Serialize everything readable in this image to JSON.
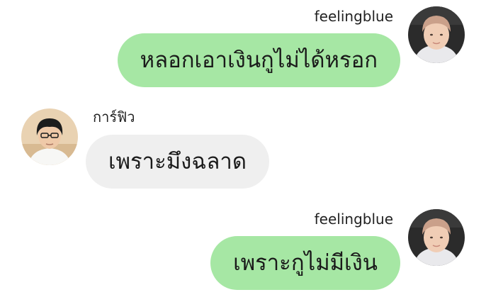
{
  "chat": {
    "messages": [
      {
        "direction": "outgoing",
        "sender": "feelingblue",
        "text": "หลอกเอาเงินกูไม่ได้หรอก",
        "avatar_icon": "user-avatar-feelingblue",
        "bubble_color": "#a6e7a4"
      },
      {
        "direction": "incoming",
        "sender": "การ์ฟิว",
        "text": "เพราะมึงฉลาด",
        "avatar_icon": "user-avatar-friend",
        "bubble_color": "#efefef"
      },
      {
        "direction": "outgoing",
        "sender": "feelingblue",
        "text": "เพราะกูไม่มีเงิน",
        "avatar_icon": "user-avatar-feelingblue",
        "bubble_color": "#a6e7a4"
      }
    ]
  }
}
